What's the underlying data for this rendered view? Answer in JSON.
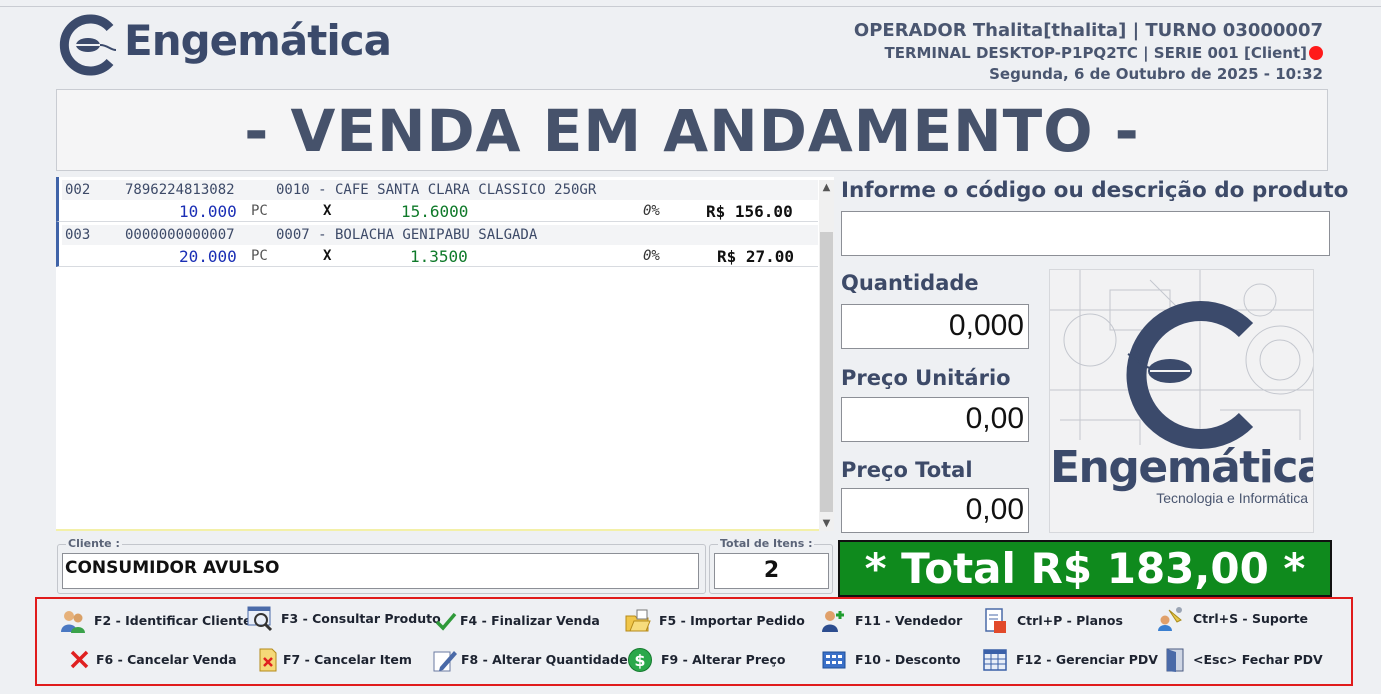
{
  "header": {
    "brand": "Engemática",
    "line1": "OPERADOR Thalita[thalita] | TURNO 03000007",
    "line2": "TERMINAL DESKTOP-P1PQ2TC | SERIE 001 [Client]",
    "line3": "Segunda, 6 de Outubro de 2025 - 10:32",
    "status_color": "#ff1a1a"
  },
  "status": "- VENDA EM ANDAMENTO -",
  "items": [
    {
      "seq": "002",
      "barcode": "7896224813082",
      "code_desc": "0010 - CAFE SANTA CLARA CLASSICO 250GR",
      "qty": "10.000",
      "unit": "PC",
      "x": "X",
      "price": "15.6000",
      "discount": "0%",
      "subtotal": "R$ 156.00"
    },
    {
      "seq": "003",
      "barcode": "0000000000007",
      "code_desc": "0007 - BOLACHA GENIPABU SALGADA",
      "qty": "20.000",
      "unit": "PC",
      "x": "X",
      "price": "1.3500",
      "discount": "0%",
      "subtotal": "R$ 27.00"
    }
  ],
  "product": {
    "search_label": "Informe o código ou descrição do produto",
    "search_value": "",
    "qty_label": "Quantidade",
    "qty_value": "0,000",
    "unit_price_label": "Preço Unitário",
    "unit_price_value": "0,00",
    "total_price_label": "Preço Total",
    "total_price_value": "0,00"
  },
  "brand_panel": {
    "name": "Engemática",
    "tagline": "Tecnologia e Informática"
  },
  "customer": {
    "label": "Cliente :",
    "value": "CONSUMIDOR AVULSO"
  },
  "total_items": {
    "label": "Total de Itens :",
    "value": "2"
  },
  "total": "* Total R$ 183,00 *",
  "fkeys": {
    "row1": [
      {
        "label": "F2 - Identificar Cliente",
        "icon": "users-icon"
      },
      {
        "label": "F3 - Consultar Produto",
        "icon": "magnifier-icon"
      },
      {
        "label": "F4 - Finalizar Venda",
        "icon": "checkmark-icon"
      },
      {
        "label": "F5 - Importar Pedido",
        "icon": "folder-icon"
      },
      {
        "label": "F11 - Vendedor",
        "icon": "add-user-icon"
      },
      {
        "label": "Ctrl+P - Planos",
        "icon": "document-icon"
      },
      {
        "label": "Ctrl+S - Suporte",
        "icon": "support-icon"
      }
    ],
    "row2": [
      {
        "label": "F6 - Cancelar Venda",
        "icon": "x-icon"
      },
      {
        "label": "F7 - Cancelar Item",
        "icon": "cancel-item-icon"
      },
      {
        "label": "F8 -  Alterar Quantidade",
        "icon": "edit-icon"
      },
      {
        "label": "F9 - Alterar Preço",
        "icon": "dollar-icon"
      },
      {
        "label": "F10 - Desconto",
        "icon": "calculator-icon"
      },
      {
        "label": "F12 - Gerenciar PDV",
        "icon": "grid-icon"
      },
      {
        "label": "<Esc> Fechar PDV",
        "icon": "door-icon"
      }
    ]
  }
}
